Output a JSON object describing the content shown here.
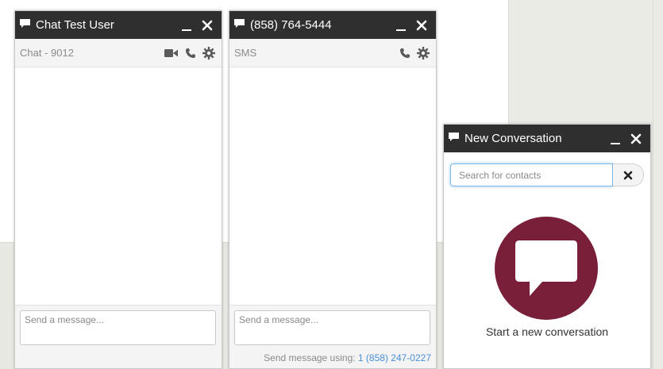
{
  "windows": [
    {
      "title": "Chat Test User",
      "subtitle": "Chat - 9012",
      "icons": [
        "video-icon",
        "phone-icon",
        "gear-icon"
      ],
      "composer": {
        "placeholder": "Send a message..."
      }
    },
    {
      "title": "(858) 764-5444",
      "subtitle": "SMS",
      "icons": [
        "phone-icon",
        "gear-icon"
      ],
      "composer": {
        "placeholder": "Send a message..."
      },
      "send_using": {
        "label": "Send message using:",
        "number": "1 (858) 247-0227"
      }
    }
  ],
  "new_conversation": {
    "title": "New Conversation",
    "search": {
      "placeholder": "Search for contacts",
      "value": ""
    },
    "cta_label": "Start a new conversation"
  },
  "colors": {
    "titlebar": "#2f2f2f",
    "accent": "#7a1f3a",
    "link": "#4a90d9",
    "focus": "#7cb6e6"
  }
}
